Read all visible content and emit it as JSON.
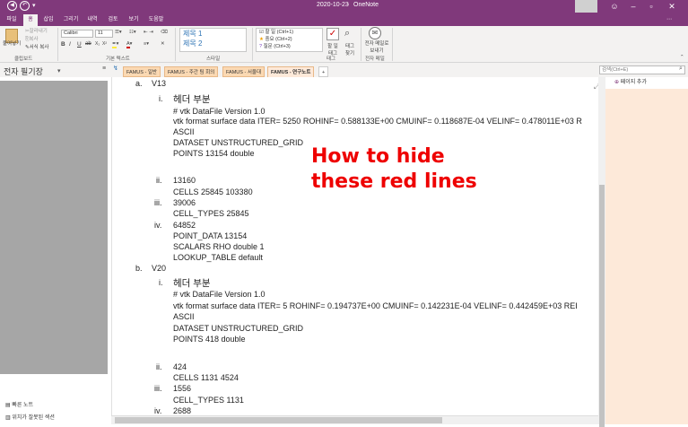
{
  "window": {
    "date": "2020-10-23",
    "app": "OneNote"
  },
  "tabs": [
    "파일",
    "홈",
    "삽입",
    "그리기",
    "내역",
    "검토",
    "보기",
    "도움말"
  ],
  "ribbon": {
    "paste": "붙여넣기",
    "cut": "잘라내기",
    "copy": "복사",
    "format_copy": "서식 복사",
    "clipboard": "클립보드",
    "basic_text": "기본 텍스트",
    "style": "스타일",
    "tags": "태그",
    "email": "전자 메일",
    "font": "Calibri",
    "size": "11",
    "styles": [
      "제목 1",
      "제목 2"
    ],
    "tag_items": [
      "할 일 (Ctrl+1)",
      "중요 (Ctrl+2)",
      "질문 (Ctrl+3)"
    ],
    "todo_tag": "할 일 태그",
    "find_tags": "태그 찾기",
    "email_page": "전자 메일로 보내기"
  },
  "nav": {
    "notebook": "전자 필기장",
    "sections": [
      "FAMUS - 일반",
      "FAMUS - 주간 팀 회의",
      "FAMUS - 서울대",
      "FAMUS - 연구노트"
    ],
    "add": "+",
    "search_placeholder": "검색(Ctrl+E)"
  },
  "left": {
    "quick_notes": "빠른 노트",
    "unfiled": "위치가 잘못된 섹션"
  },
  "right": {
    "add_page": "페이지 추가"
  },
  "content": {
    "a": "a.",
    "v13": "V13",
    "i": "i.",
    "header": "헤더 부분",
    "vtk": "# vtk DataFile Version 1.0",
    "fmt1": "vtk format surface data ITER=        5250 ROHINF=   0.588133E+00 CMUINF=   0.118687E-04 VELINF=   0.478011E+03 R",
    "ascii": "ASCII",
    "dataset": "DATASET UNSTRUCTURED_GRID",
    "points1": "POINTS        13154 double",
    "ii": "ii.",
    "n13160": "13160",
    "cells1": "CELLS        25845       103380",
    "iii": "iii.",
    "n39006": "39006",
    "ct1": "CELL_TYPES        25845",
    "iv": "iv.",
    "n64852": "64852",
    "pd1": "POINT_DATA        13154",
    "scalars": "SCALARS RHO  double 1",
    "lookup": "LOOKUP_TABLE default",
    "b": "b.",
    "v20": "V20",
    "fmt2": "vtk format surface data ITER=           5 ROHINF=   0.194737E+00 CMUINF=   0.142231E-04 VELINF=   0.442459E+03 REI",
    "points2": "POINTS          418 double",
    "n424": "424",
    "cells2": "CELLS         1131         4524",
    "n1556": "1556",
    "ct2": "CELL_TYPES         1131",
    "n2688": "2688",
    "overlay": [
      "How to hide",
      "these red lines"
    ]
  },
  "colors": {
    "brand": "#80397b",
    "overlay": "#e00000",
    "peach": "#fde9d9"
  }
}
